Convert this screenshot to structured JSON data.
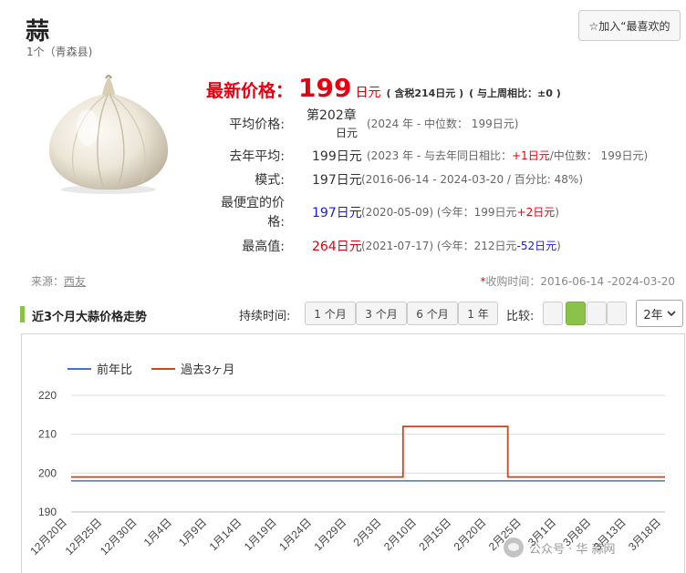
{
  "header": {
    "title": "蒜",
    "subtitle": "1个（青森县)",
    "favorite_label": "☆加入“最喜欢的"
  },
  "price": {
    "latest_label": "最新价格：",
    "latest_value": "199",
    "latest_unit": "日元",
    "tax_note": "( 含税214日元 )",
    "week_compare": "( 与上周相比：±0 )",
    "avg_label": "平均价格:",
    "avg_value": "第202章",
    "avg_unit": "日元",
    "avg_detail": "(2024 年 - 中位数： 199日元)",
    "last_year_label": "去年平均:",
    "last_year_value": "199日元",
    "last_year_detail_a": "(2023 年 - 与去年同日相比：",
    "last_year_detail_diff": "+1日元",
    "last_year_detail_b": "/中位数： 199日元)",
    "mode_label": "模式:",
    "mode_value": "197日元",
    "mode_detail": "(2016-06-14 - 2024-03-20 / 百分比: 48%)",
    "lowest_label_1": "最便宜的价",
    "lowest_label_2": "格:",
    "lowest_value": "197日元",
    "lowest_detail_a": "(2020-05-09) (今年：199日元",
    "lowest_detail_diff": "+2日元",
    "lowest_detail_b": ")",
    "highest_label": "最高值:",
    "highest_value": "264日元",
    "highest_detail_a": "(2021-07-17) (今年：212日元",
    "highest_detail_diff": "-52日元",
    "highest_detail_b": ")"
  },
  "meta": {
    "source_label": "来源：",
    "source_link": "西友",
    "period_star": "*",
    "period_text": "收购时间：2016-06-14 -2024-03-20"
  },
  "controls": {
    "section_title": "近3个月大蒜价格走势",
    "duration_label": "持续时间:",
    "durations": [
      "1 个月",
      "3 个月",
      "6 个月",
      "1 年"
    ],
    "compare_label": "比较:",
    "year_select": "2年"
  },
  "colors": {
    "accent_red": "#e60012",
    "accent_green": "#8bc34a",
    "series_prev_year": "#4a6fd4",
    "series_last_3m": "#c8471f"
  },
  "watermark": "公众号 · 华 蒜网",
  "chart_data": {
    "type": "line",
    "ylim": [
      190,
      220
    ],
    "yticks": [
      190,
      200,
      210,
      220
    ],
    "grid": true,
    "legend_position": "top-left",
    "x": [
      "12月20日",
      "12月25日",
      "12月30日",
      "1月4日",
      "1月9日",
      "1月14日",
      "1月19日",
      "1月24日",
      "1月29日",
      "2月3日",
      "2月10日",
      "2月15日",
      "2月20日",
      "2月25日",
      "3月1日",
      "3月8日",
      "3月13日",
      "3月18日"
    ],
    "series": [
      {
        "name": "前年比",
        "color": "#4a6fd4",
        "values": [
          198,
          198,
          198,
          198,
          198,
          198,
          198,
          198,
          198,
          198,
          198,
          198,
          198,
          198,
          198,
          198,
          198,
          198
        ]
      },
      {
        "name": "過去3ヶ月",
        "color": "#c8471f",
        "values": [
          199,
          199,
          199,
          199,
          199,
          199,
          199,
          199,
          199,
          199,
          212,
          212,
          212,
          199,
          199,
          199,
          199,
          199
        ]
      }
    ]
  }
}
